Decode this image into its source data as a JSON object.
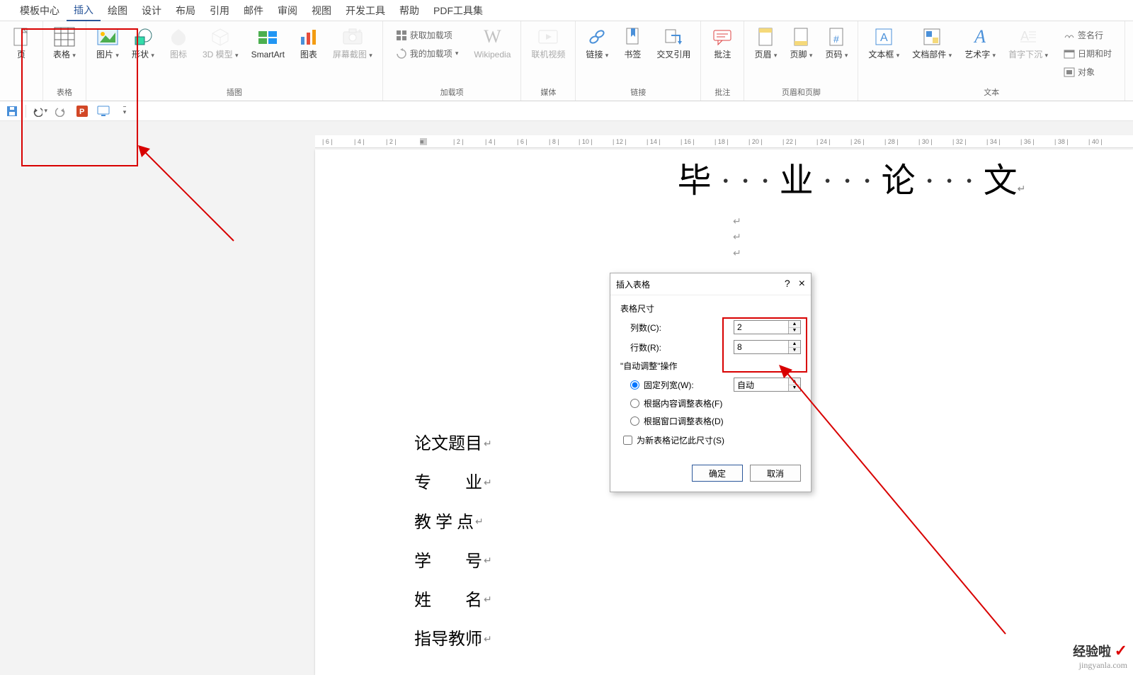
{
  "tabs": {
    "template_center": "模板中心",
    "insert": "插入",
    "draw": "绘图",
    "design": "设计",
    "layout": "布局",
    "references": "引用",
    "mailings": "邮件",
    "review": "审阅",
    "view": "视图",
    "developer": "开发工具",
    "help": "帮助",
    "pdf_tools": "PDF工具集"
  },
  "ribbon": {
    "page": "页",
    "table": "表格",
    "picture": "图片",
    "shapes": "形状",
    "icons": "图标",
    "model3d": "3D 模型",
    "smartart": "SmartArt",
    "chart": "图表",
    "screenshot": "屏幕截图",
    "get_addins": "获取加载项",
    "my_addins": "我的加载项",
    "wikipedia": "Wikipedia",
    "online_video": "联机视频",
    "link": "链接",
    "bookmark": "书签",
    "cross_ref": "交叉引用",
    "comment": "批注",
    "header": "页眉",
    "footer": "页脚",
    "page_number": "页码",
    "text_box": "文本框",
    "quick_parts": "文档部件",
    "wordart": "艺术字",
    "drop_cap": "首字下沉",
    "signature": "签名行",
    "date_time": "日期和时",
    "object": "对象",
    "g_illustrations": "插图",
    "g_addins": "加载项",
    "g_media": "媒体",
    "g_links": "链接",
    "g_comments": "批注",
    "g_header_footer": "页眉和页脚",
    "g_text": "文本",
    "g_table": "表格"
  },
  "document": {
    "title_char1": "毕",
    "title_char2": "业",
    "title_char3": "论",
    "title_char4": "文",
    "line1": "论文题目",
    "line2": "专　　业",
    "line3": "教 学 点",
    "line4": "学　　号",
    "line5": "姓　　名",
    "line6": "指导教师"
  },
  "dialog": {
    "title": "插入表格",
    "help": "?",
    "close": "×",
    "section_size": "表格尺寸",
    "cols_label": "列数(C):",
    "cols_value": "2",
    "rows_label": "行数(R):",
    "rows_value": "8",
    "section_autofit": "\"自动调整\"操作",
    "fixed_width": "固定列宽(W):",
    "fixed_value": "自动",
    "fit_content": "根据内容调整表格(F)",
    "fit_window": "根据窗口调整表格(D)",
    "remember": "为新表格记忆此尺寸(S)",
    "ok": "确定",
    "cancel": "取消"
  },
  "watermark": {
    "main": "经验啦",
    "check": "✓",
    "sub": "jingyanla.com"
  },
  "ruler_marks": [
    "6",
    "4",
    "2",
    "",
    "2",
    "4",
    "6",
    "8",
    "10",
    "12",
    "14",
    "16",
    "18",
    "20",
    "22",
    "24",
    "26",
    "28",
    "30",
    "32",
    "34",
    "36",
    "38",
    "40"
  ]
}
